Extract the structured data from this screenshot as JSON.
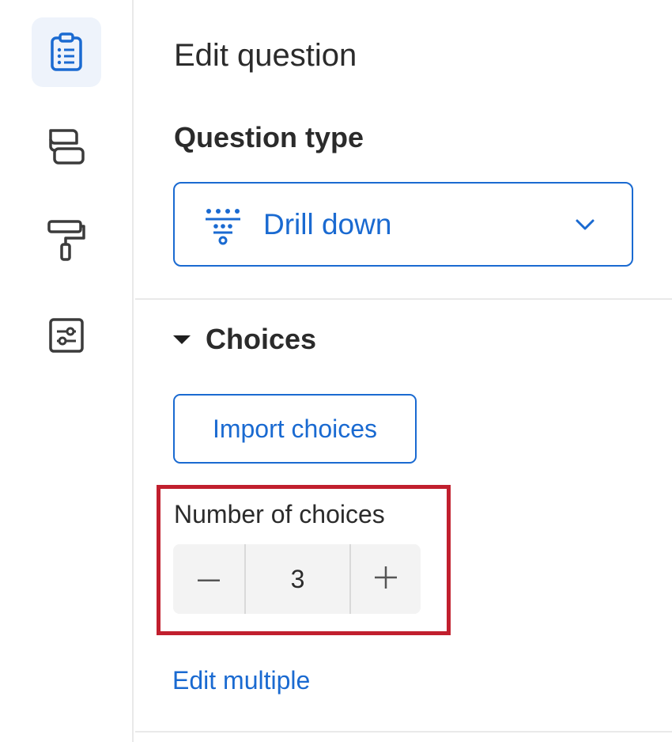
{
  "colors": {
    "accent": "#1a6ad1",
    "highlight": "#c11f2e",
    "rail_active_bg": "#eef3fb"
  },
  "rail": {
    "items": [
      {
        "icon": "clipboard-list-icon",
        "active": true
      },
      {
        "icon": "layout-blocks-icon",
        "active": false
      },
      {
        "icon": "paint-roller-icon",
        "active": false
      },
      {
        "icon": "sliders-settings-icon",
        "active": false
      }
    ]
  },
  "panel": {
    "title": "Edit question",
    "question_type": {
      "label": "Question type",
      "value": "Drill down",
      "icon": "drill-down-icon"
    },
    "choices": {
      "label": "Choices",
      "import_label": "Import choices",
      "number_label": "Number of choices",
      "number_value": "3",
      "edit_multiple_label": "Edit multiple"
    }
  }
}
